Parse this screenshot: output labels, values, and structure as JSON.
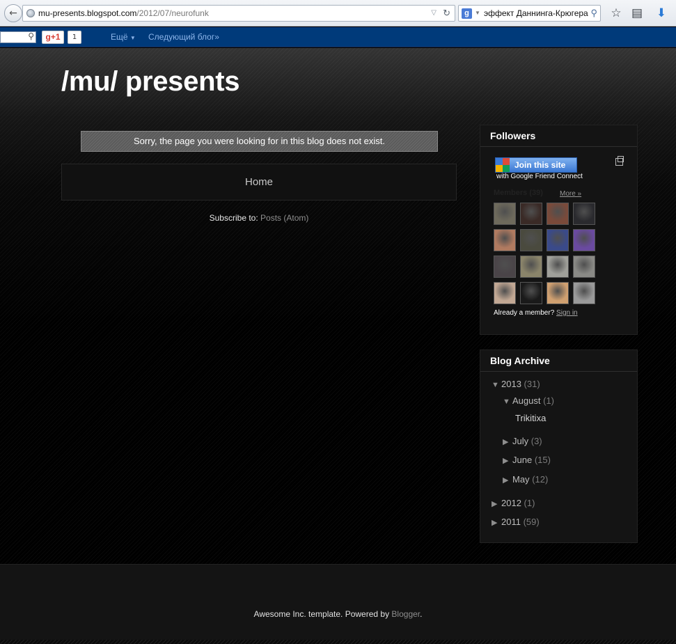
{
  "browser": {
    "url_host": "mu-presents.blogspot.com",
    "url_path": "/2012/07/neurofunk",
    "search_query": "эффект Даннинга-Крюгера"
  },
  "navbar": {
    "gplus_label": "g+1",
    "gplus_count": "1",
    "more_label": "Ещё",
    "next_blog_label": "Следующий блог»"
  },
  "blog": {
    "title": "/mu/ presents",
    "status_message": "Sorry, the page you were looking for in this blog does not exist.",
    "home_link": "Home",
    "subscribe_prefix": "Subscribe to:",
    "subscribe_link": "Posts (Atom)"
  },
  "followers": {
    "title": "Followers",
    "join_button": "Join this site",
    "join_sub": "with Google Friend Connect",
    "members_label": "Members (39)",
    "more_link": "More »",
    "already_text": "Already a member?",
    "sign_in_link": "Sign in",
    "avatar_colors": [
      "#6e6a5c",
      "#3a2a26",
      "#7a4a3a",
      "#2a2a2e",
      "#b07a60",
      "#4a4a3e",
      "#3a4a8a",
      "#6a4aa0",
      "#4a4448",
      "#8a846a",
      "#a0a09a",
      "#8a8a86",
      "#c2a894",
      "#1a1a1a",
      "#d0a070",
      "#9a9a9a"
    ]
  },
  "archive": {
    "title": "Blog Archive",
    "y2013": {
      "label": "2013",
      "count": "(31)"
    },
    "august": {
      "label": "August",
      "count": "(1)"
    },
    "post": "Trikitixa",
    "july": {
      "label": "July",
      "count": "(3)"
    },
    "june": {
      "label": "June",
      "count": "(15)"
    },
    "may": {
      "label": "May",
      "count": "(12)"
    },
    "y2012": {
      "label": "2012",
      "count": "(1)"
    },
    "y2011": {
      "label": "2011",
      "count": "(59)"
    }
  },
  "footer": {
    "text": "Awesome Inc. template. Powered by",
    "link": "Blogger",
    "period": "."
  }
}
